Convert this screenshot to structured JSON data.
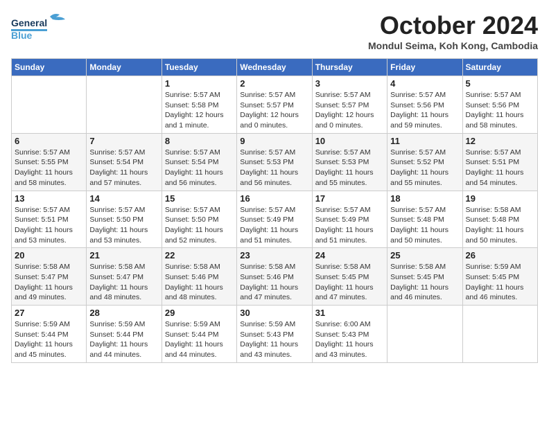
{
  "header": {
    "logo_line1": "General",
    "logo_line2": "Blue",
    "month_title": "October 2024",
    "location": "Mondul Seima, Koh Kong, Cambodia"
  },
  "days_of_week": [
    "Sunday",
    "Monday",
    "Tuesday",
    "Wednesday",
    "Thursday",
    "Friday",
    "Saturday"
  ],
  "weeks": [
    [
      {
        "day": "",
        "info": ""
      },
      {
        "day": "",
        "info": ""
      },
      {
        "day": "1",
        "info": "Sunrise: 5:57 AM\nSunset: 5:58 PM\nDaylight: 12 hours and 1 minute."
      },
      {
        "day": "2",
        "info": "Sunrise: 5:57 AM\nSunset: 5:57 PM\nDaylight: 12 hours and 0 minutes."
      },
      {
        "day": "3",
        "info": "Sunrise: 5:57 AM\nSunset: 5:57 PM\nDaylight: 12 hours and 0 minutes."
      },
      {
        "day": "4",
        "info": "Sunrise: 5:57 AM\nSunset: 5:56 PM\nDaylight: 11 hours and 59 minutes."
      },
      {
        "day": "5",
        "info": "Sunrise: 5:57 AM\nSunset: 5:56 PM\nDaylight: 11 hours and 58 minutes."
      }
    ],
    [
      {
        "day": "6",
        "info": "Sunrise: 5:57 AM\nSunset: 5:55 PM\nDaylight: 11 hours and 58 minutes."
      },
      {
        "day": "7",
        "info": "Sunrise: 5:57 AM\nSunset: 5:54 PM\nDaylight: 11 hours and 57 minutes."
      },
      {
        "day": "8",
        "info": "Sunrise: 5:57 AM\nSunset: 5:54 PM\nDaylight: 11 hours and 56 minutes."
      },
      {
        "day": "9",
        "info": "Sunrise: 5:57 AM\nSunset: 5:53 PM\nDaylight: 11 hours and 56 minutes."
      },
      {
        "day": "10",
        "info": "Sunrise: 5:57 AM\nSunset: 5:53 PM\nDaylight: 11 hours and 55 minutes."
      },
      {
        "day": "11",
        "info": "Sunrise: 5:57 AM\nSunset: 5:52 PM\nDaylight: 11 hours and 55 minutes."
      },
      {
        "day": "12",
        "info": "Sunrise: 5:57 AM\nSunset: 5:51 PM\nDaylight: 11 hours and 54 minutes."
      }
    ],
    [
      {
        "day": "13",
        "info": "Sunrise: 5:57 AM\nSunset: 5:51 PM\nDaylight: 11 hours and 53 minutes."
      },
      {
        "day": "14",
        "info": "Sunrise: 5:57 AM\nSunset: 5:50 PM\nDaylight: 11 hours and 53 minutes."
      },
      {
        "day": "15",
        "info": "Sunrise: 5:57 AM\nSunset: 5:50 PM\nDaylight: 11 hours and 52 minutes."
      },
      {
        "day": "16",
        "info": "Sunrise: 5:57 AM\nSunset: 5:49 PM\nDaylight: 11 hours and 51 minutes."
      },
      {
        "day": "17",
        "info": "Sunrise: 5:57 AM\nSunset: 5:49 PM\nDaylight: 11 hours and 51 minutes."
      },
      {
        "day": "18",
        "info": "Sunrise: 5:57 AM\nSunset: 5:48 PM\nDaylight: 11 hours and 50 minutes."
      },
      {
        "day": "19",
        "info": "Sunrise: 5:58 AM\nSunset: 5:48 PM\nDaylight: 11 hours and 50 minutes."
      }
    ],
    [
      {
        "day": "20",
        "info": "Sunrise: 5:58 AM\nSunset: 5:47 PM\nDaylight: 11 hours and 49 minutes."
      },
      {
        "day": "21",
        "info": "Sunrise: 5:58 AM\nSunset: 5:47 PM\nDaylight: 11 hours and 48 minutes."
      },
      {
        "day": "22",
        "info": "Sunrise: 5:58 AM\nSunset: 5:46 PM\nDaylight: 11 hours and 48 minutes."
      },
      {
        "day": "23",
        "info": "Sunrise: 5:58 AM\nSunset: 5:46 PM\nDaylight: 11 hours and 47 minutes."
      },
      {
        "day": "24",
        "info": "Sunrise: 5:58 AM\nSunset: 5:45 PM\nDaylight: 11 hours and 47 minutes."
      },
      {
        "day": "25",
        "info": "Sunrise: 5:58 AM\nSunset: 5:45 PM\nDaylight: 11 hours and 46 minutes."
      },
      {
        "day": "26",
        "info": "Sunrise: 5:59 AM\nSunset: 5:45 PM\nDaylight: 11 hours and 46 minutes."
      }
    ],
    [
      {
        "day": "27",
        "info": "Sunrise: 5:59 AM\nSunset: 5:44 PM\nDaylight: 11 hours and 45 minutes."
      },
      {
        "day": "28",
        "info": "Sunrise: 5:59 AM\nSunset: 5:44 PM\nDaylight: 11 hours and 44 minutes."
      },
      {
        "day": "29",
        "info": "Sunrise: 5:59 AM\nSunset: 5:44 PM\nDaylight: 11 hours and 44 minutes."
      },
      {
        "day": "30",
        "info": "Sunrise: 5:59 AM\nSunset: 5:43 PM\nDaylight: 11 hours and 43 minutes."
      },
      {
        "day": "31",
        "info": "Sunrise: 6:00 AM\nSunset: 5:43 PM\nDaylight: 11 hours and 43 minutes."
      },
      {
        "day": "",
        "info": ""
      },
      {
        "day": "",
        "info": ""
      }
    ]
  ]
}
